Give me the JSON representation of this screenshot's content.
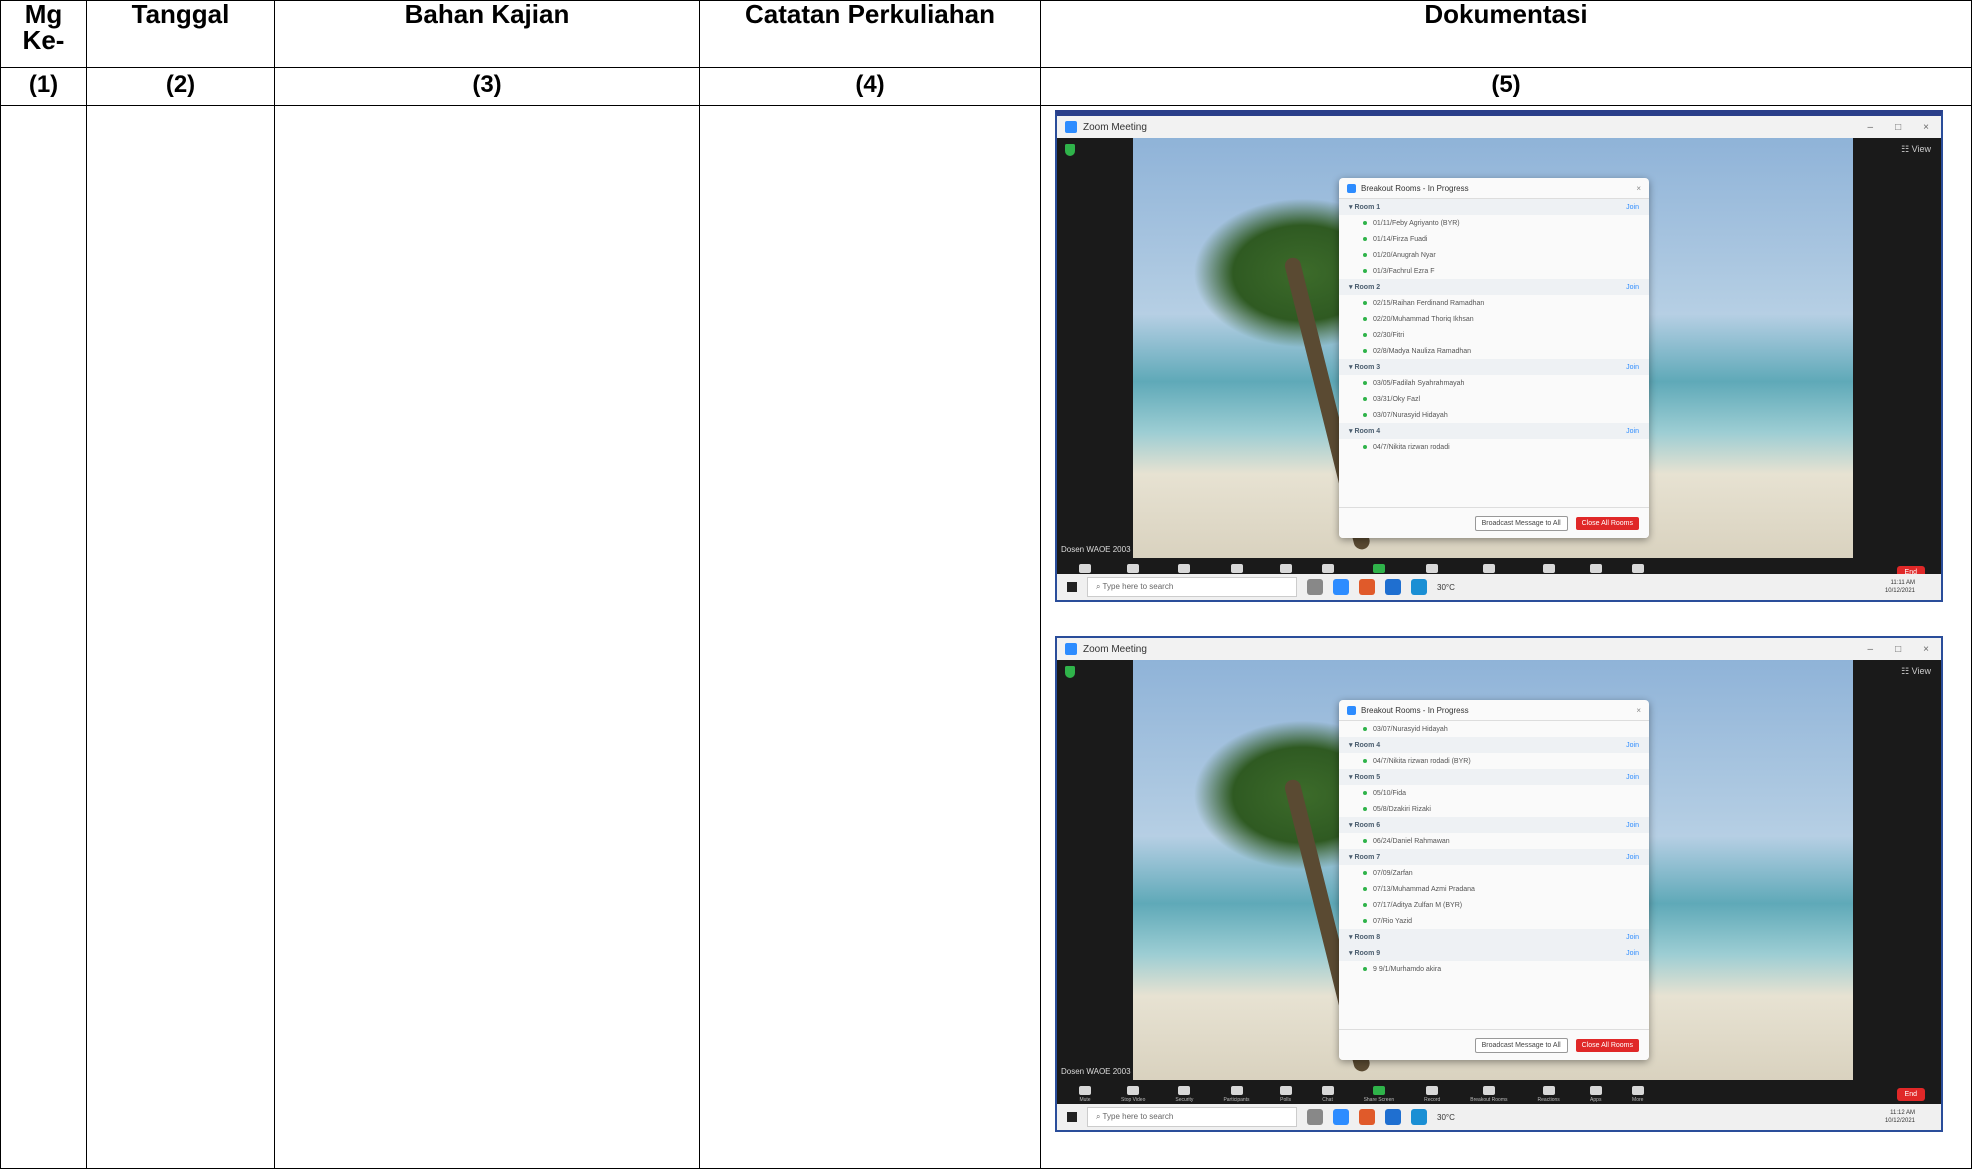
{
  "headers": [
    "Mg Ke-",
    "Tanggal",
    "Bahan Kajian",
    "Catatan Perkuliahan",
    "Dokumentasi"
  ],
  "numbers": [
    "(1)",
    "(2)",
    "(3)",
    "(4)",
    "(5)"
  ],
  "screenshots": [
    {
      "window_title": "Zoom Meeting",
      "panel_title": "Breakout Rooms - In Progress",
      "rows": [
        {
          "kind": "room",
          "label": "Room 1",
          "join": "Join"
        },
        {
          "kind": "person",
          "label": "01/11/Feby Agriyanto (BYR)"
        },
        {
          "kind": "person",
          "label": "01/14/Firza Fuadi"
        },
        {
          "kind": "person",
          "label": "01/20/Anugrah Nyar"
        },
        {
          "kind": "person",
          "label": "01/3/Fachrul Ezra F"
        },
        {
          "kind": "room",
          "label": "Room 2",
          "join": "Join"
        },
        {
          "kind": "person",
          "label": "02/15/Raihan Ferdinand Ramadhan"
        },
        {
          "kind": "person",
          "label": "02/20/Muhammad Thoriq Ikhsan"
        },
        {
          "kind": "person",
          "label": "02/30/Fitri"
        },
        {
          "kind": "person",
          "label": "02/8/Madya Nauliza Ramadhan"
        },
        {
          "kind": "room",
          "label": "Room 3",
          "join": "Join"
        },
        {
          "kind": "person",
          "label": "03/05/Fadilah Syahrahmayah"
        },
        {
          "kind": "person",
          "label": "03/31/Oky Fazl"
        },
        {
          "kind": "person",
          "label": "03/07/Nurasyid Hidayah"
        },
        {
          "kind": "room",
          "label": "Room 4",
          "join": "Join"
        },
        {
          "kind": "person",
          "label": "04/7/Nikita rizwan rodadi"
        }
      ],
      "broadcast_label": "Broadcast Message to All",
      "close_label": "Close All Rooms",
      "view_label": "View",
      "username": "Dosen WAOE 2003",
      "controls": [
        "Mute",
        "Stop Video",
        "Security",
        "Participants",
        "Polls",
        "Chat",
        "Share Screen",
        "Record",
        "Breakout Rooms",
        "Reactions",
        "Apps",
        "More"
      ],
      "end_label": "End",
      "search_placeholder": "Type here to search",
      "weather": "30°C",
      "time": "11:11 AM",
      "date": "10/12/2021"
    },
    {
      "window_title": "Zoom Meeting",
      "panel_title": "Breakout Rooms - In Progress",
      "rows": [
        {
          "kind": "person",
          "label": "03/07/Nurasyid Hidayah"
        },
        {
          "kind": "room",
          "label": "Room 4",
          "join": "Join"
        },
        {
          "kind": "person",
          "label": "04/7/Nikita rizwan rodadi (BYR)"
        },
        {
          "kind": "room",
          "label": "Room 5",
          "join": "Join"
        },
        {
          "kind": "person",
          "label": "05/10/Fida"
        },
        {
          "kind": "person",
          "label": "05/8/Dzakiri Rizaki"
        },
        {
          "kind": "room",
          "label": "Room 6",
          "join": "Join"
        },
        {
          "kind": "person",
          "label": "06/24/Daniel Rahmawan"
        },
        {
          "kind": "room",
          "label": "Room 7",
          "join": "Join"
        },
        {
          "kind": "person",
          "label": "07/09/Zarfan"
        },
        {
          "kind": "person",
          "label": "07/13/Muhammad Azmi Pradana"
        },
        {
          "kind": "person",
          "label": "07/17/Aditya Zulfan M (BYR)"
        },
        {
          "kind": "person",
          "label": "07/Rio Yazid"
        },
        {
          "kind": "room",
          "label": "Room 8",
          "join": "Join"
        },
        {
          "kind": "room",
          "label": "Room 9",
          "join": "Join"
        },
        {
          "kind": "person",
          "label": "9 9/1/Murhamdo akira"
        }
      ],
      "broadcast_label": "Broadcast Message to All",
      "close_label": "Close All Rooms",
      "view_label": "View",
      "username": "Dosen WAOE 2003",
      "controls": [
        "Mute",
        "Stop Video",
        "Security",
        "Participants",
        "Polls",
        "Chat",
        "Share Screen",
        "Record",
        "Breakout Rooms",
        "Reactions",
        "Apps",
        "More"
      ],
      "end_label": "End",
      "search_placeholder": "Type here to search",
      "weather": "30°C",
      "time": "11:12 AM",
      "date": "10/12/2021"
    }
  ],
  "colors": {
    "zoom_blue": "#2d8cff",
    "end_red": "#e02828",
    "share_green": "#2fb34a"
  }
}
